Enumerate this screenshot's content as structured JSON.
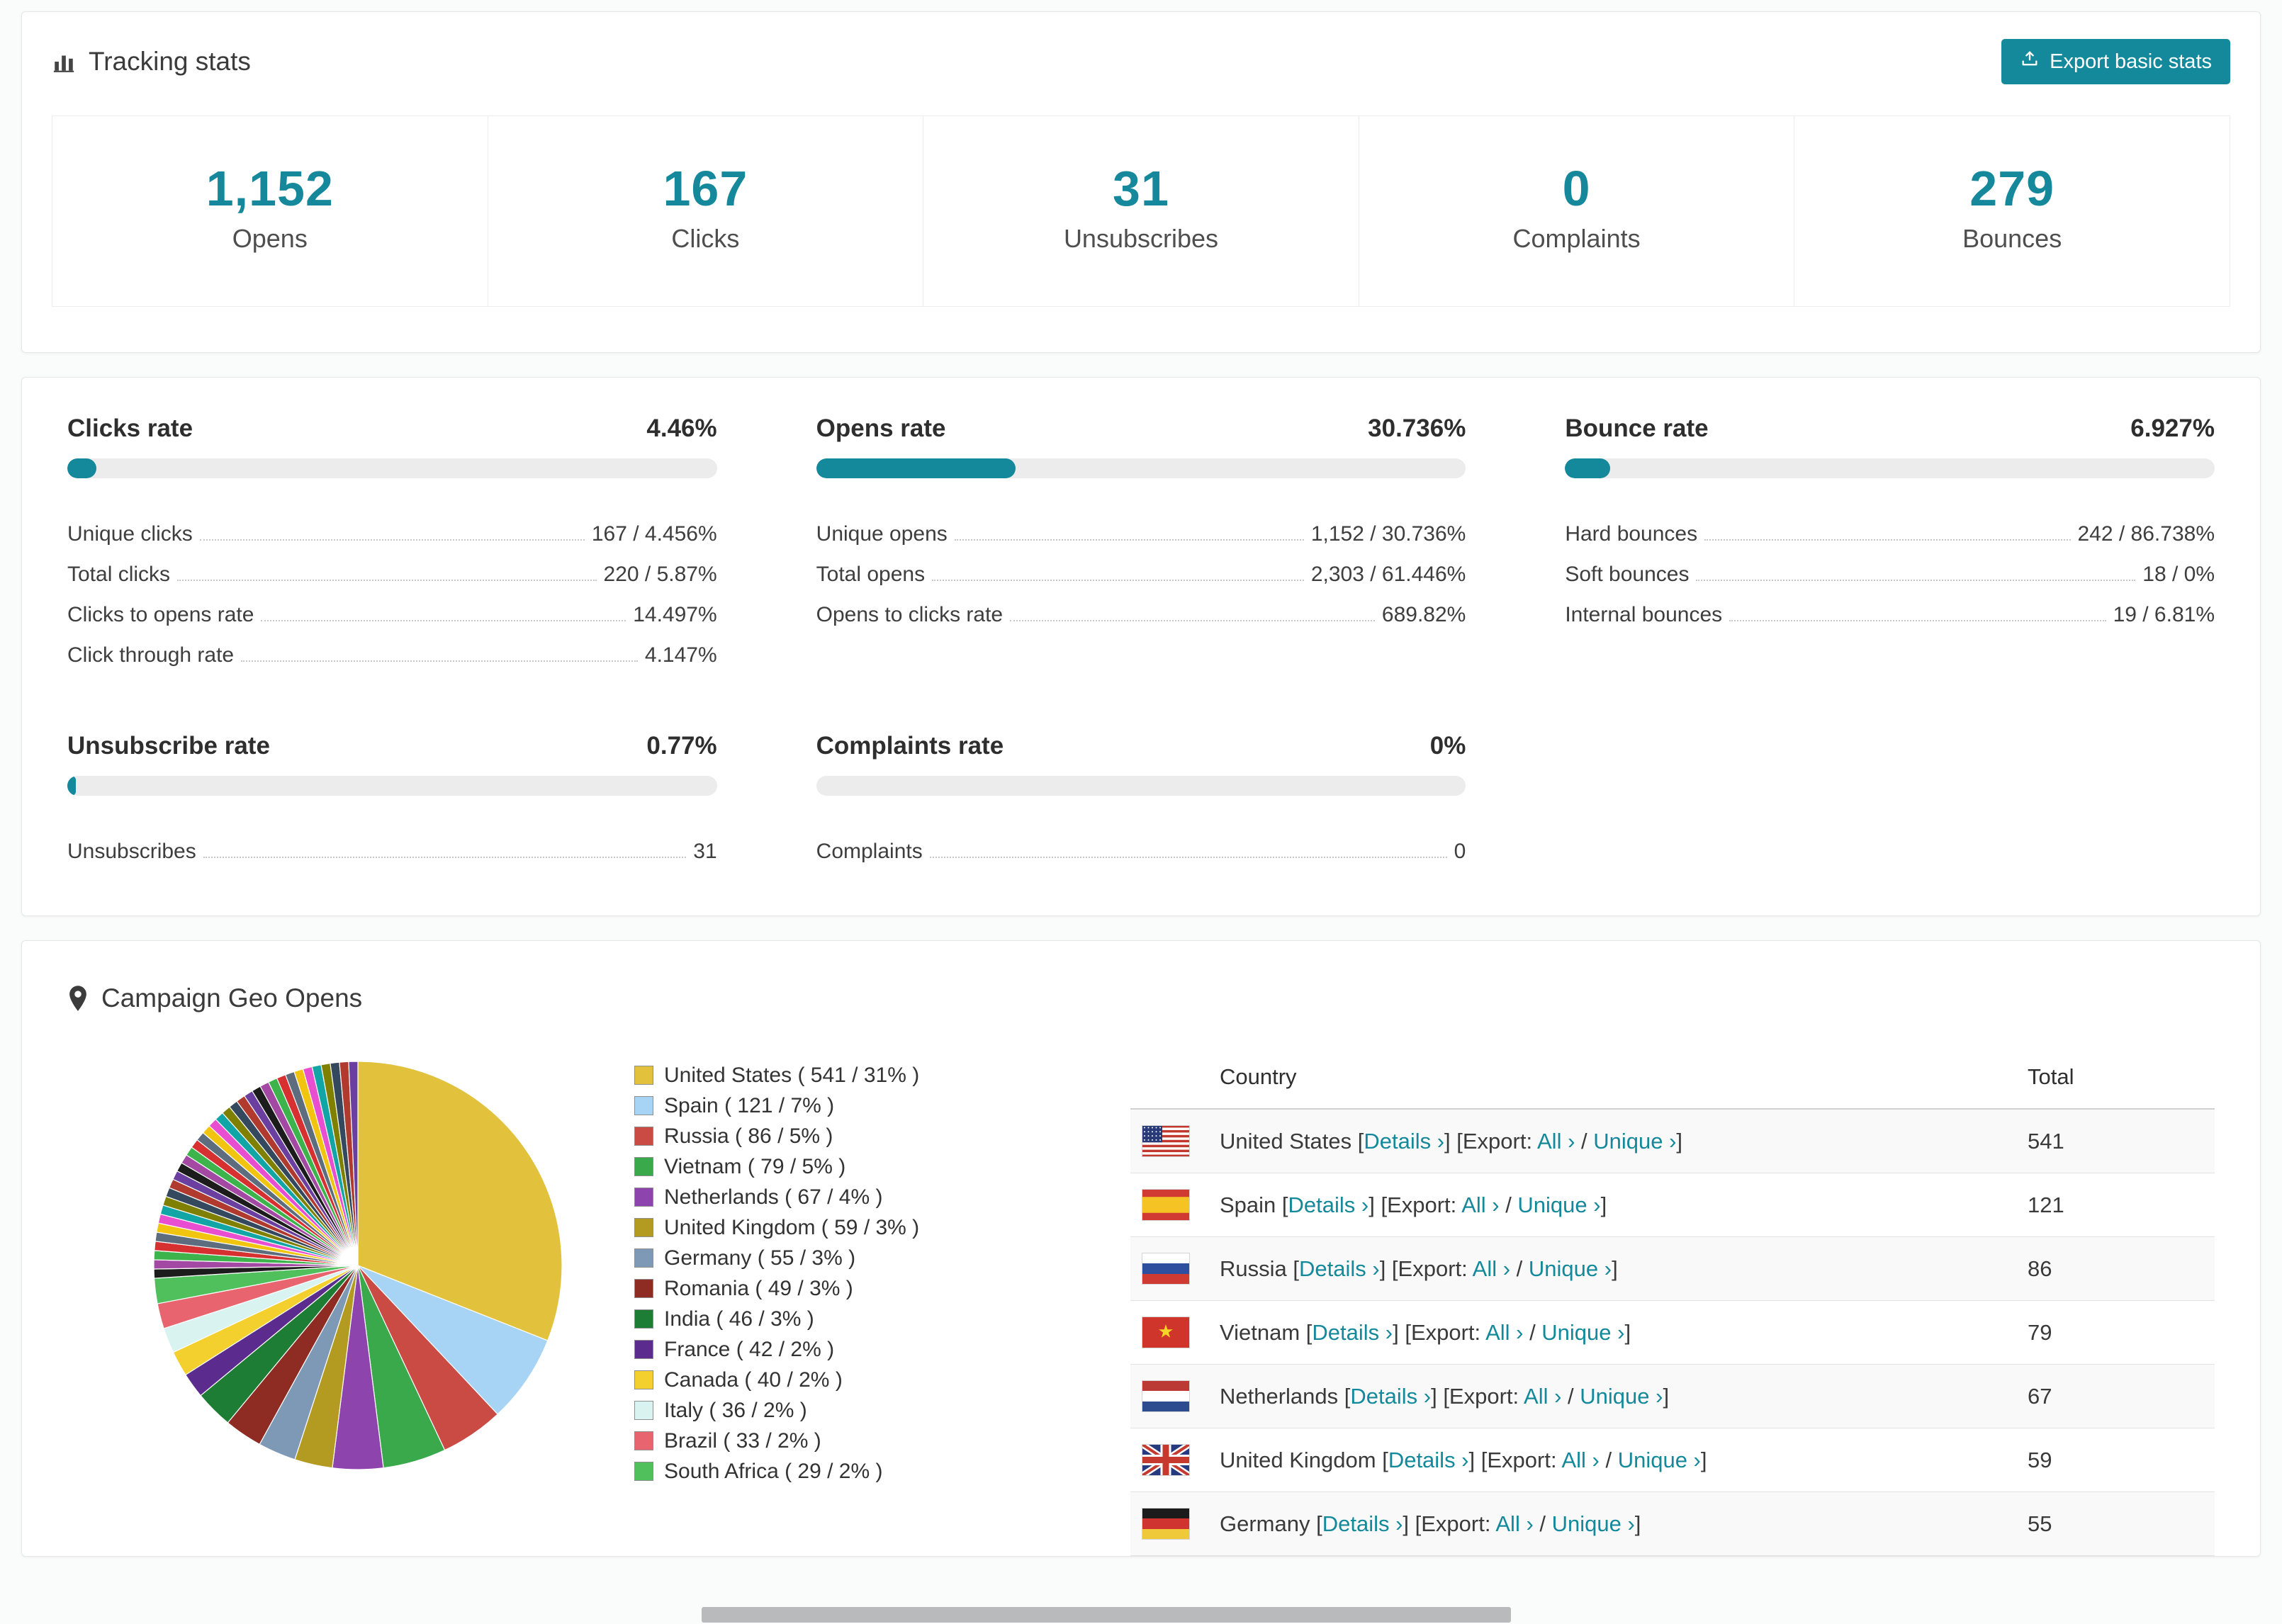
{
  "colors": {
    "accent": "#13899b",
    "stat_number": "#15889c",
    "progress_track": "#ececec"
  },
  "tracking": {
    "title": "Tracking stats",
    "export_button": "Export basic stats",
    "stats": [
      {
        "value": "1,152",
        "label": "Opens"
      },
      {
        "value": "167",
        "label": "Clicks"
      },
      {
        "value": "31",
        "label": "Unsubscribes"
      },
      {
        "value": "0",
        "label": "Complaints"
      },
      {
        "value": "279",
        "label": "Bounces"
      }
    ]
  },
  "rates": [
    {
      "title": "Clicks rate",
      "value": "4.46%",
      "percent": 4.46,
      "rows": [
        {
          "label": "Unique clicks",
          "value": "167 / 4.456%"
        },
        {
          "label": "Total clicks",
          "value": "220 / 5.87%"
        },
        {
          "label": "Clicks to opens rate",
          "value": "14.497%"
        },
        {
          "label": "Click through rate",
          "value": "4.147%"
        }
      ]
    },
    {
      "title": "Opens rate",
      "value": "30.736%",
      "percent": 30.736,
      "rows": [
        {
          "label": "Unique opens",
          "value": "1,152 / 30.736%"
        },
        {
          "label": "Total opens",
          "value": "2,303 / 61.446%"
        },
        {
          "label": "Opens to clicks rate",
          "value": "689.82%"
        }
      ]
    },
    {
      "title": "Bounce rate",
      "value": "6.927%",
      "percent": 6.927,
      "rows": [
        {
          "label": "Hard bounces",
          "value": "242 / 86.738%"
        },
        {
          "label": "Soft bounces",
          "value": "18 / 0%"
        },
        {
          "label": "Internal bounces",
          "value": "19 / 6.81%"
        }
      ]
    },
    {
      "title": "Unsubscribe rate",
      "value": "0.77%",
      "percent": 0.77,
      "rows": [
        {
          "label": "Unsubscribes",
          "value": "31"
        }
      ]
    },
    {
      "title": "Complaints rate",
      "value": "0%",
      "percent": 0,
      "rows": [
        {
          "label": "Complaints",
          "value": "0"
        }
      ]
    }
  ],
  "geo": {
    "title": "Campaign Geo Opens",
    "table": {
      "country_header": "Country",
      "total_header": "Total",
      "details_label": "Details ›",
      "export_label": "Export:",
      "all_label": "All ›",
      "unique_label": "Unique ›",
      "rows": [
        {
          "country": "United States",
          "flag": "us",
          "total": "541"
        },
        {
          "country": "Spain",
          "flag": "es",
          "total": "121"
        },
        {
          "country": "Russia",
          "flag": "ru",
          "total": "86"
        },
        {
          "country": "Vietnam",
          "flag": "vn",
          "total": "79"
        },
        {
          "country": "Netherlands",
          "flag": "nl",
          "total": "67"
        },
        {
          "country": "United Kingdom",
          "flag": "gb",
          "total": "59"
        },
        {
          "country": "Germany",
          "flag": "de",
          "total": "55"
        }
      ]
    }
  },
  "chart_data": {
    "type": "pie",
    "title": "Campaign Geo Opens",
    "legend_position": "right",
    "legend_format": "{label} ( {value} / {percent}% )",
    "slices": [
      {
        "label": "United States",
        "value": 541,
        "percent": 31,
        "color": "#e2c23d"
      },
      {
        "label": "Spain",
        "value": 121,
        "percent": 7,
        "color": "#a7d4f4"
      },
      {
        "label": "Russia",
        "value": 86,
        "percent": 5,
        "color": "#ca4a44"
      },
      {
        "label": "Vietnam",
        "value": 79,
        "percent": 5,
        "color": "#3aa94c"
      },
      {
        "label": "Netherlands",
        "value": 67,
        "percent": 4,
        "color": "#8e44ad"
      },
      {
        "label": "United Kingdom",
        "value": 59,
        "percent": 3,
        "color": "#b39a20"
      },
      {
        "label": "Germany",
        "value": 55,
        "percent": 3,
        "color": "#7d99b5"
      },
      {
        "label": "Romania",
        "value": 49,
        "percent": 3,
        "color": "#8e2b22"
      },
      {
        "label": "India",
        "value": 46,
        "percent": 3,
        "color": "#1e7d35"
      },
      {
        "label": "France",
        "value": 42,
        "percent": 2,
        "color": "#5b2b8d"
      },
      {
        "label": "Canada",
        "value": 40,
        "percent": 2,
        "color": "#f3d02e"
      },
      {
        "label": "Italy",
        "value": 36,
        "percent": 2,
        "color": "#d9f3f1"
      },
      {
        "label": "Brazil",
        "value": 33,
        "percent": 2,
        "color": "#e8646e"
      },
      {
        "label": "South Africa",
        "value": 29,
        "percent": 2,
        "color": "#4fc05c"
      }
    ],
    "others": {
      "percent": 26,
      "slice_count": 36,
      "colors": [
        "#1c1c1c",
        "#a349a4",
        "#3cb44b",
        "#d63031",
        "#5d6d7e",
        "#f1c40f",
        "#e84fd0",
        "#12a5a5",
        "#7f8000",
        "#34495e",
        "#b03a2e",
        "#6a3fa0"
      ]
    }
  }
}
